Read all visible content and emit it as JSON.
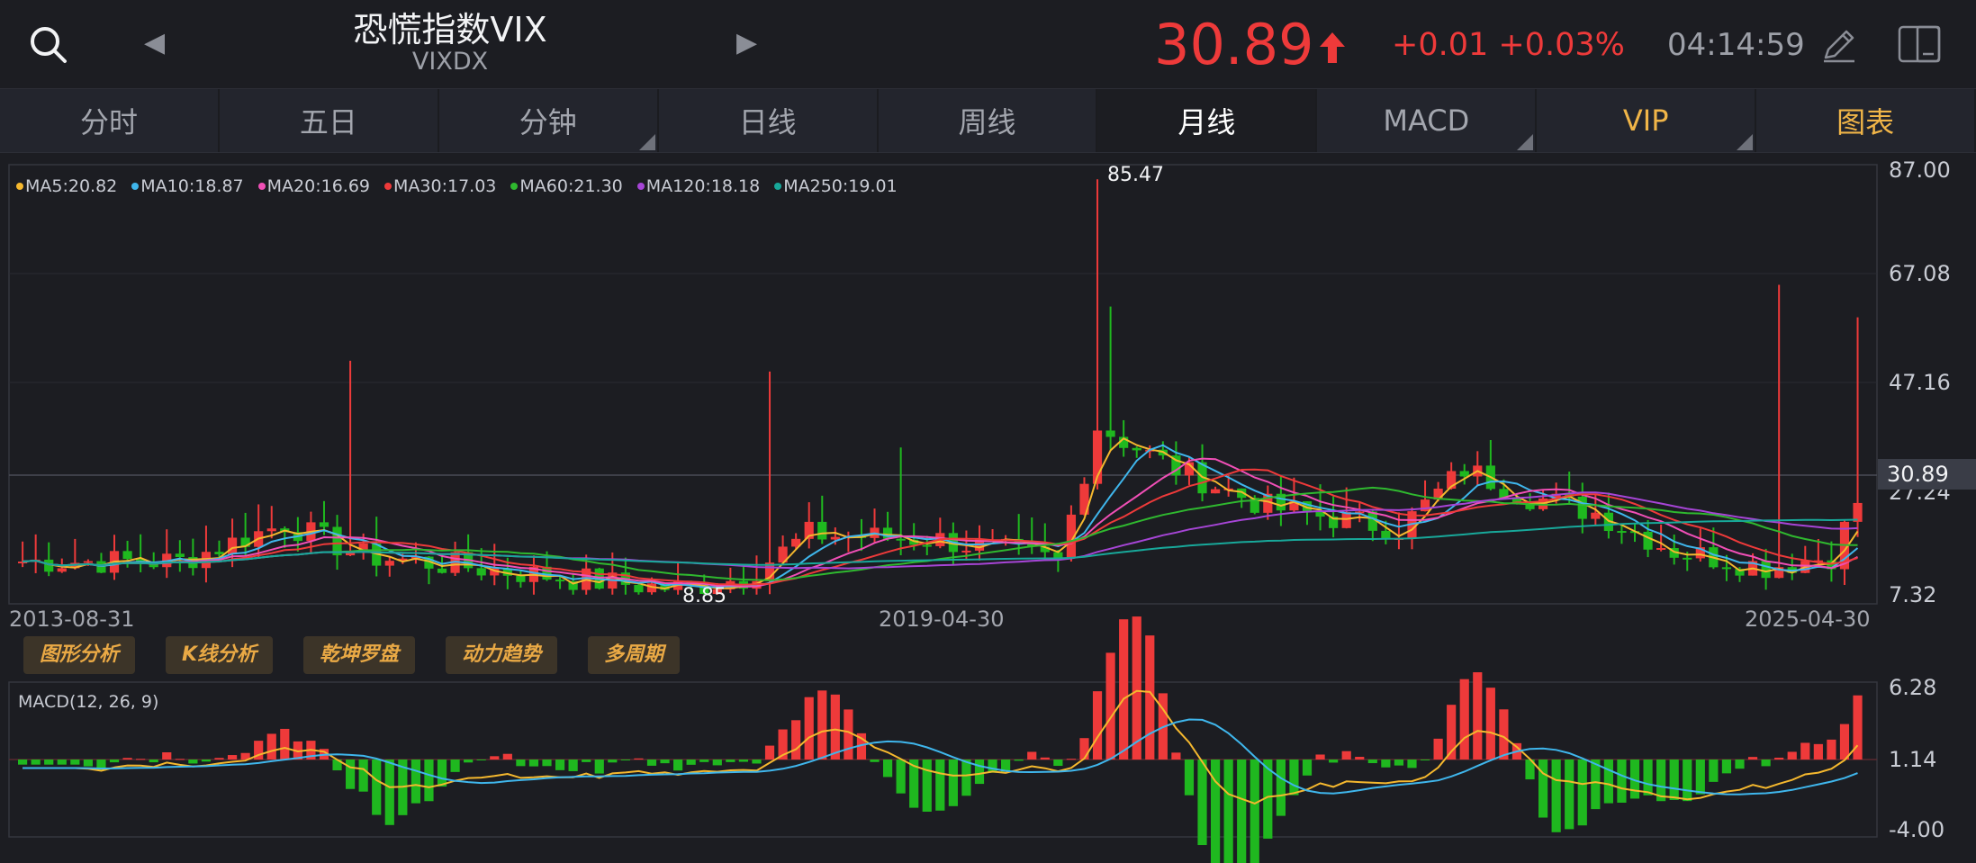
{
  "header": {
    "title": "恐慌指数VIX",
    "code": "VIXDX",
    "price": "30.89",
    "change": "+0.01 +0.03%",
    "time": "04:14:59",
    "up_color": "#ee3a3a"
  },
  "tabs": [
    {
      "label": "分时",
      "active": false,
      "has_menu": false,
      "accent": false
    },
    {
      "label": "五日",
      "active": false,
      "has_menu": false,
      "accent": false
    },
    {
      "label": "分钟",
      "active": false,
      "has_menu": true,
      "accent": false
    },
    {
      "label": "日线",
      "active": false,
      "has_menu": false,
      "accent": false
    },
    {
      "label": "周线",
      "active": false,
      "has_menu": false,
      "accent": false
    },
    {
      "label": "月线",
      "active": true,
      "has_menu": false,
      "accent": false
    },
    {
      "label": "MACD",
      "active": false,
      "has_menu": true,
      "accent": false
    },
    {
      "label": "VIP",
      "active": false,
      "has_menu": true,
      "accent": true
    },
    {
      "label": "图表",
      "active": false,
      "has_menu": false,
      "accent": true
    }
  ],
  "ma_legend": [
    {
      "label": "MA5:20.82",
      "color": "#f5b82e"
    },
    {
      "label": "MA10:18.87",
      "color": "#3fb6ec"
    },
    {
      "label": "MA20:16.69",
      "color": "#f04fb6"
    },
    {
      "label": "MA30:17.03",
      "color": "#ee3a3a"
    },
    {
      "label": "MA60:21.30",
      "color": "#2fb82f"
    },
    {
      "label": "MA120:18.18",
      "color": "#a645d6"
    },
    {
      "label": "MA250:19.01",
      "color": "#18a89a"
    }
  ],
  "price_axis": {
    "ticks": [
      "87.00",
      "67.08",
      "47.16",
      "27.24",
      "7.32"
    ],
    "current": "30.89",
    "high": "85.47",
    "low": "8.85"
  },
  "date_axis": [
    "2013-08-31",
    "2019-04-30",
    "2025-04-30"
  ],
  "tools": [
    "图形分析",
    "K线分析",
    "乾坤罗盘",
    "动力趋势",
    "多周期"
  ],
  "macd": {
    "label": "MACD(12, 26, 9)",
    "ticks": [
      "6.28",
      "1.14",
      "-4.00"
    ]
  },
  "chart_data": {
    "type": "candlestick",
    "period": "monthly",
    "x_range": [
      "2013-08-31",
      "2025-04-30"
    ],
    "ylim": [
      7.32,
      87.0
    ],
    "current_price": 30.89,
    "high": 85.47,
    "low": 8.85,
    "indicator": {
      "name": "MACD(12, 26, 9)",
      "ylim": [
        -4.0,
        6.28
      ],
      "zero_line": 1.14
    }
  }
}
